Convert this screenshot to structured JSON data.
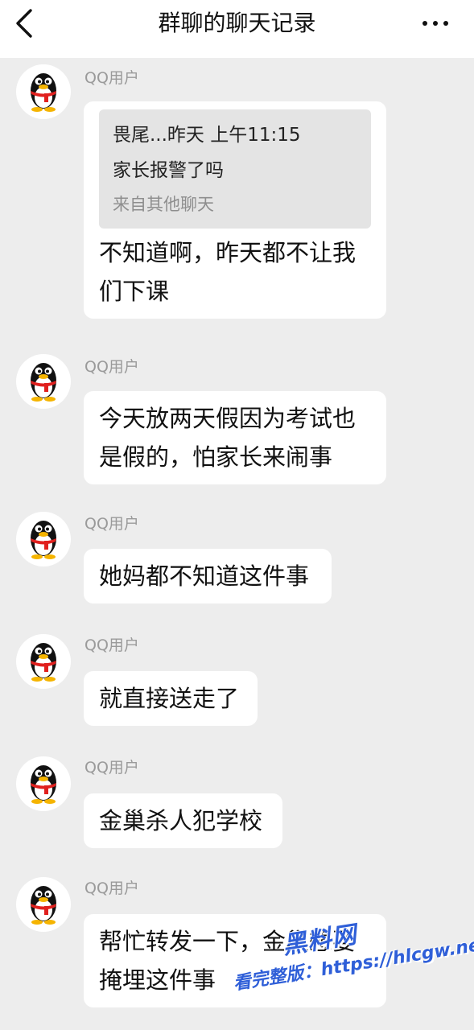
{
  "header": {
    "title": "群聊的聊天记录",
    "back_icon": "chevron-left-icon",
    "more_icon": "more-dots-icon"
  },
  "messages": [
    {
      "sender": "QQ用户",
      "quote": {
        "header": "畏尾...昨天 上午11:15",
        "text": "家长报警了吗",
        "source": "来自其他聊天"
      },
      "lines": [
        "不知道啊，昨天都不让我",
        "们下课"
      ]
    },
    {
      "sender": "QQ用户",
      "lines": [
        "今天放两天假因为考试也",
        "是假的，怕家长来闹事"
      ]
    },
    {
      "sender": "QQ用户",
      "lines": [
        "她妈都不知道这件事"
      ]
    },
    {
      "sender": "QQ用户",
      "lines": [
        "就直接送走了"
      ]
    },
    {
      "sender": "QQ用户",
      "lines": [
        "金巢杀人犯学校"
      ]
    },
    {
      "sender": "QQ用户",
      "lines": [
        "帮忙转发一下，金巢想要",
        "掩埋这件事"
      ]
    }
  ],
  "watermark": {
    "site": "黑料网",
    "url": "看完整版：https://hlcgw.net"
  },
  "colors": {
    "background": "#ededed",
    "bubble": "#ffffff",
    "quote_bg": "#e4e4e4",
    "sender_gray": "#9a9a9a",
    "avatar_scarf": "#e0201e",
    "watermark_blue": "#2f5fd8"
  }
}
